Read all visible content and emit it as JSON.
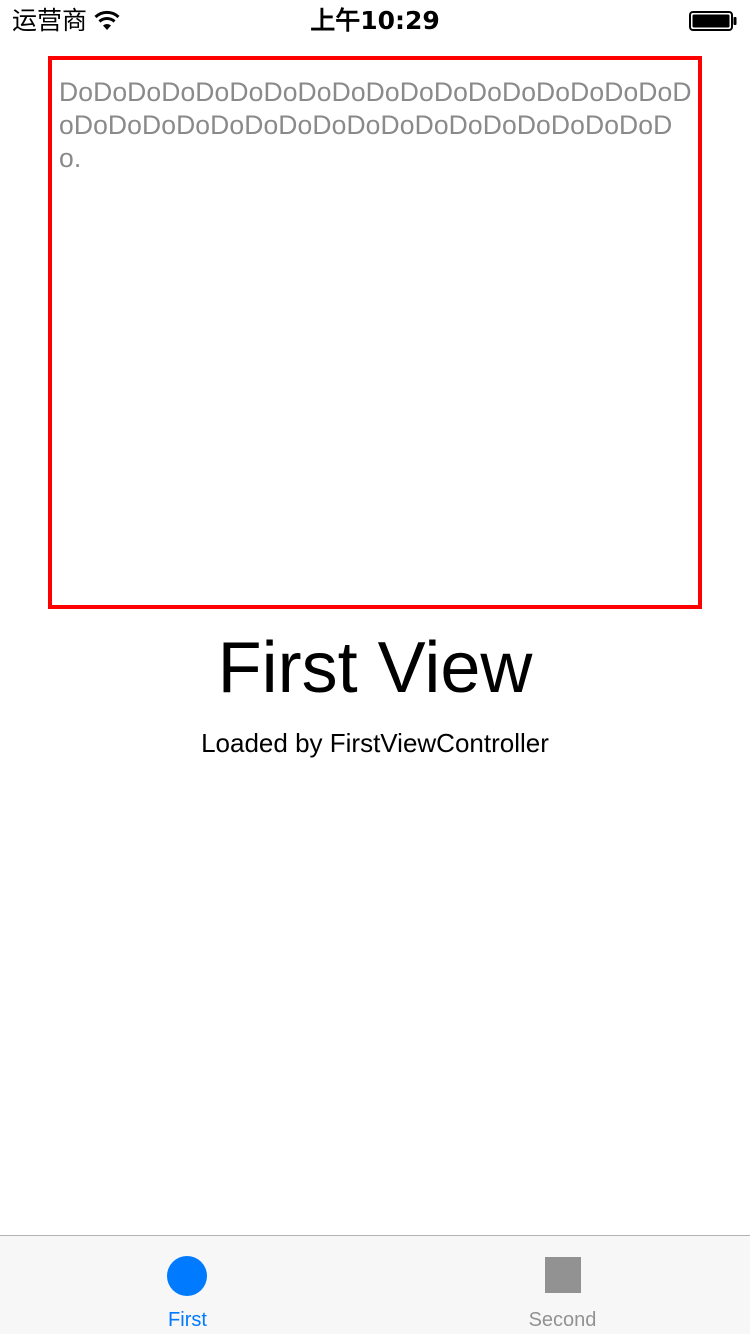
{
  "status_bar": {
    "carrier": "运营商",
    "time": "上午10:29"
  },
  "text_view": {
    "text": "DoDoDoDoDoDoDoDoDoDoDoDoDoDoDoDoDoDoDoDoDoDoDoDoDoDoDoDoDoDoDoDoDoDoDoDoDo."
  },
  "main": {
    "title": "First View",
    "subtitle": "Loaded by FirstViewController"
  },
  "tab_bar": {
    "tabs": [
      {
        "label": "First",
        "icon": "circle-icon",
        "selected": true
      },
      {
        "label": "Second",
        "icon": "square-icon",
        "selected": false
      }
    ]
  },
  "colors": {
    "accent": "#007aff",
    "inactive": "#929292",
    "border": "#ff0000"
  }
}
